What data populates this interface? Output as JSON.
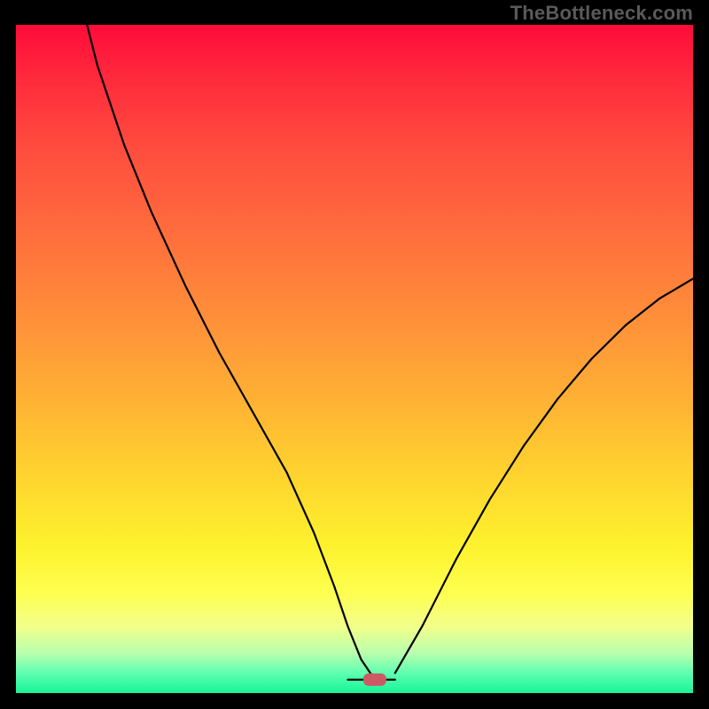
{
  "watermark": "TheBottleneck.com",
  "colors": {
    "background": "#000000",
    "gradient_top": "#ff0b3a",
    "gradient_mid1": "#ff8a3a",
    "gradient_mid2": "#fdf22d",
    "gradient_bottom": "#18f49a",
    "curve": "#000000",
    "marker": "#cc5b64"
  },
  "chart_data": {
    "type": "line",
    "title": "",
    "xlabel": "",
    "ylabel": "",
    "xlim": [
      0,
      100
    ],
    "ylim": [
      0,
      100
    ],
    "marker": {
      "x": 53,
      "y": 2
    },
    "series": [
      {
        "name": "left-branch",
        "x": [
          8,
          12,
          16,
          20,
          25,
          30,
          35,
          40,
          44,
          47,
          49,
          51,
          53
        ],
        "y": [
          110,
          94,
          82,
          72,
          61,
          51,
          42,
          33,
          24,
          16,
          10,
          5,
          2
        ]
      },
      {
        "name": "flat-minimum",
        "x": [
          49,
          56
        ],
        "y": [
          2,
          2
        ]
      },
      {
        "name": "right-branch",
        "x": [
          56,
          60,
          65,
          70,
          75,
          80,
          85,
          90,
          95,
          100
        ],
        "y": [
          3,
          10,
          20,
          29,
          37,
          44,
          50,
          55,
          59,
          62
        ]
      }
    ]
  }
}
